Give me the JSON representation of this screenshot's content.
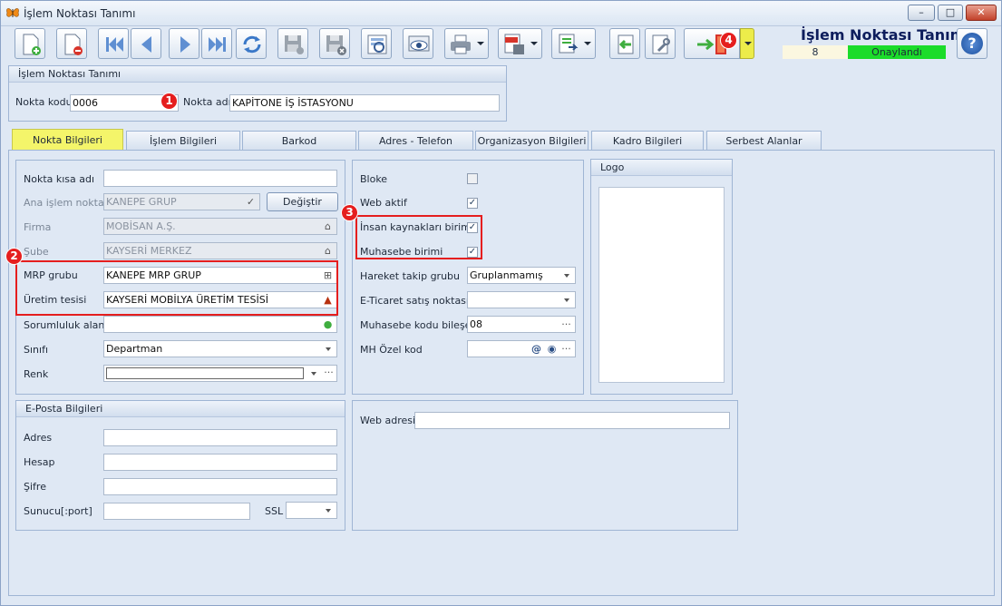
{
  "window": {
    "title": "İşlem Noktası Tanımı",
    "minimize": "–",
    "maximize": "□",
    "close": "✕"
  },
  "header": {
    "form_title": "İşlem Noktası Tanımı",
    "record_no": "8",
    "status": "Onaylandı",
    "status_color": "#1bdc2a",
    "help": "?"
  },
  "toolbar": {
    "icons": [
      "new-icon",
      "delete-icon",
      "first-icon",
      "previous-icon",
      "next-icon",
      "last-icon",
      "refresh-icon",
      "save-icon",
      "save-close-icon",
      "preview-icon",
      "view-icon",
      "print-icon",
      "pdf-export-icon",
      "export-icon",
      "back-icon",
      "tools-icon",
      "exit-icon"
    ]
  },
  "point_group": {
    "title": "İşlem Noktası Tanımı",
    "code_label": "Nokta kodu",
    "code_value": "0006",
    "name_label": "Nokta adı",
    "name_value": "KAPİTONE İŞ İSTASYONU"
  },
  "tabs": [
    "Nokta Bilgileri",
    "İşlem Bilgileri",
    "Barkod",
    "Adres - Telefon",
    "Organizasyon Bilgileri",
    "Kadro Bilgileri",
    "Serbest Alanlar"
  ],
  "general": {
    "short_name_label": "Nokta kısa adı",
    "short_name_value": "",
    "main_point_label": "Ana işlem noktası",
    "main_point_value": "KANEPE GRUP",
    "change_button": "Değiştir",
    "company_label": "Firma",
    "company_value": "MOBİSAN A.Ş.",
    "branch_label": "Şube",
    "branch_value": "KAYSERİ MERKEZ",
    "mrp_label": "MRP grubu",
    "mrp_value": "KANEPE MRP GRUP",
    "facility_label": "Üretim tesisi",
    "facility_value": "KAYSERİ MOBİLYA ÜRETİM TESİSİ",
    "responsibility_label": "Sorumluluk alanı",
    "responsibility_value": "",
    "class_label": "Sınıfı",
    "class_value": "Departman",
    "color_label": "Renk",
    "color_more": "···"
  },
  "flags": {
    "block_label": "Bloke",
    "block_checked": false,
    "web_active_label": "Web aktif",
    "web_active_checked": true,
    "hr_label": "İnsan kaynakları birimi",
    "hr_checked": true,
    "accounting_label": "Muhasebe birimi",
    "accounting_checked": true,
    "tracking_label": "Hareket takip grubu",
    "tracking_value": "Gruplanmamış",
    "ecommerce_label": "E-Ticaret satış noktası",
    "ecommerce_value": "",
    "acc_code_label": "Muhasebe kodu bileşeni",
    "acc_code_value": "08",
    "acc_code_more": "···",
    "mh_label": "MH Özel kod",
    "mh_value": "",
    "mh_at": "@",
    "mh_more": "···"
  },
  "logo": {
    "title": "Logo"
  },
  "email": {
    "title": "E-Posta Bilgileri",
    "address_label": "Adres",
    "account_label": "Hesap",
    "password_label": "Şifre",
    "server_label": "Sunucu[:port]",
    "ssl_label": "SSL"
  },
  "web": {
    "label": "Web adresi",
    "value": ""
  },
  "callouts": [
    "1",
    "2",
    "3",
    "4"
  ]
}
